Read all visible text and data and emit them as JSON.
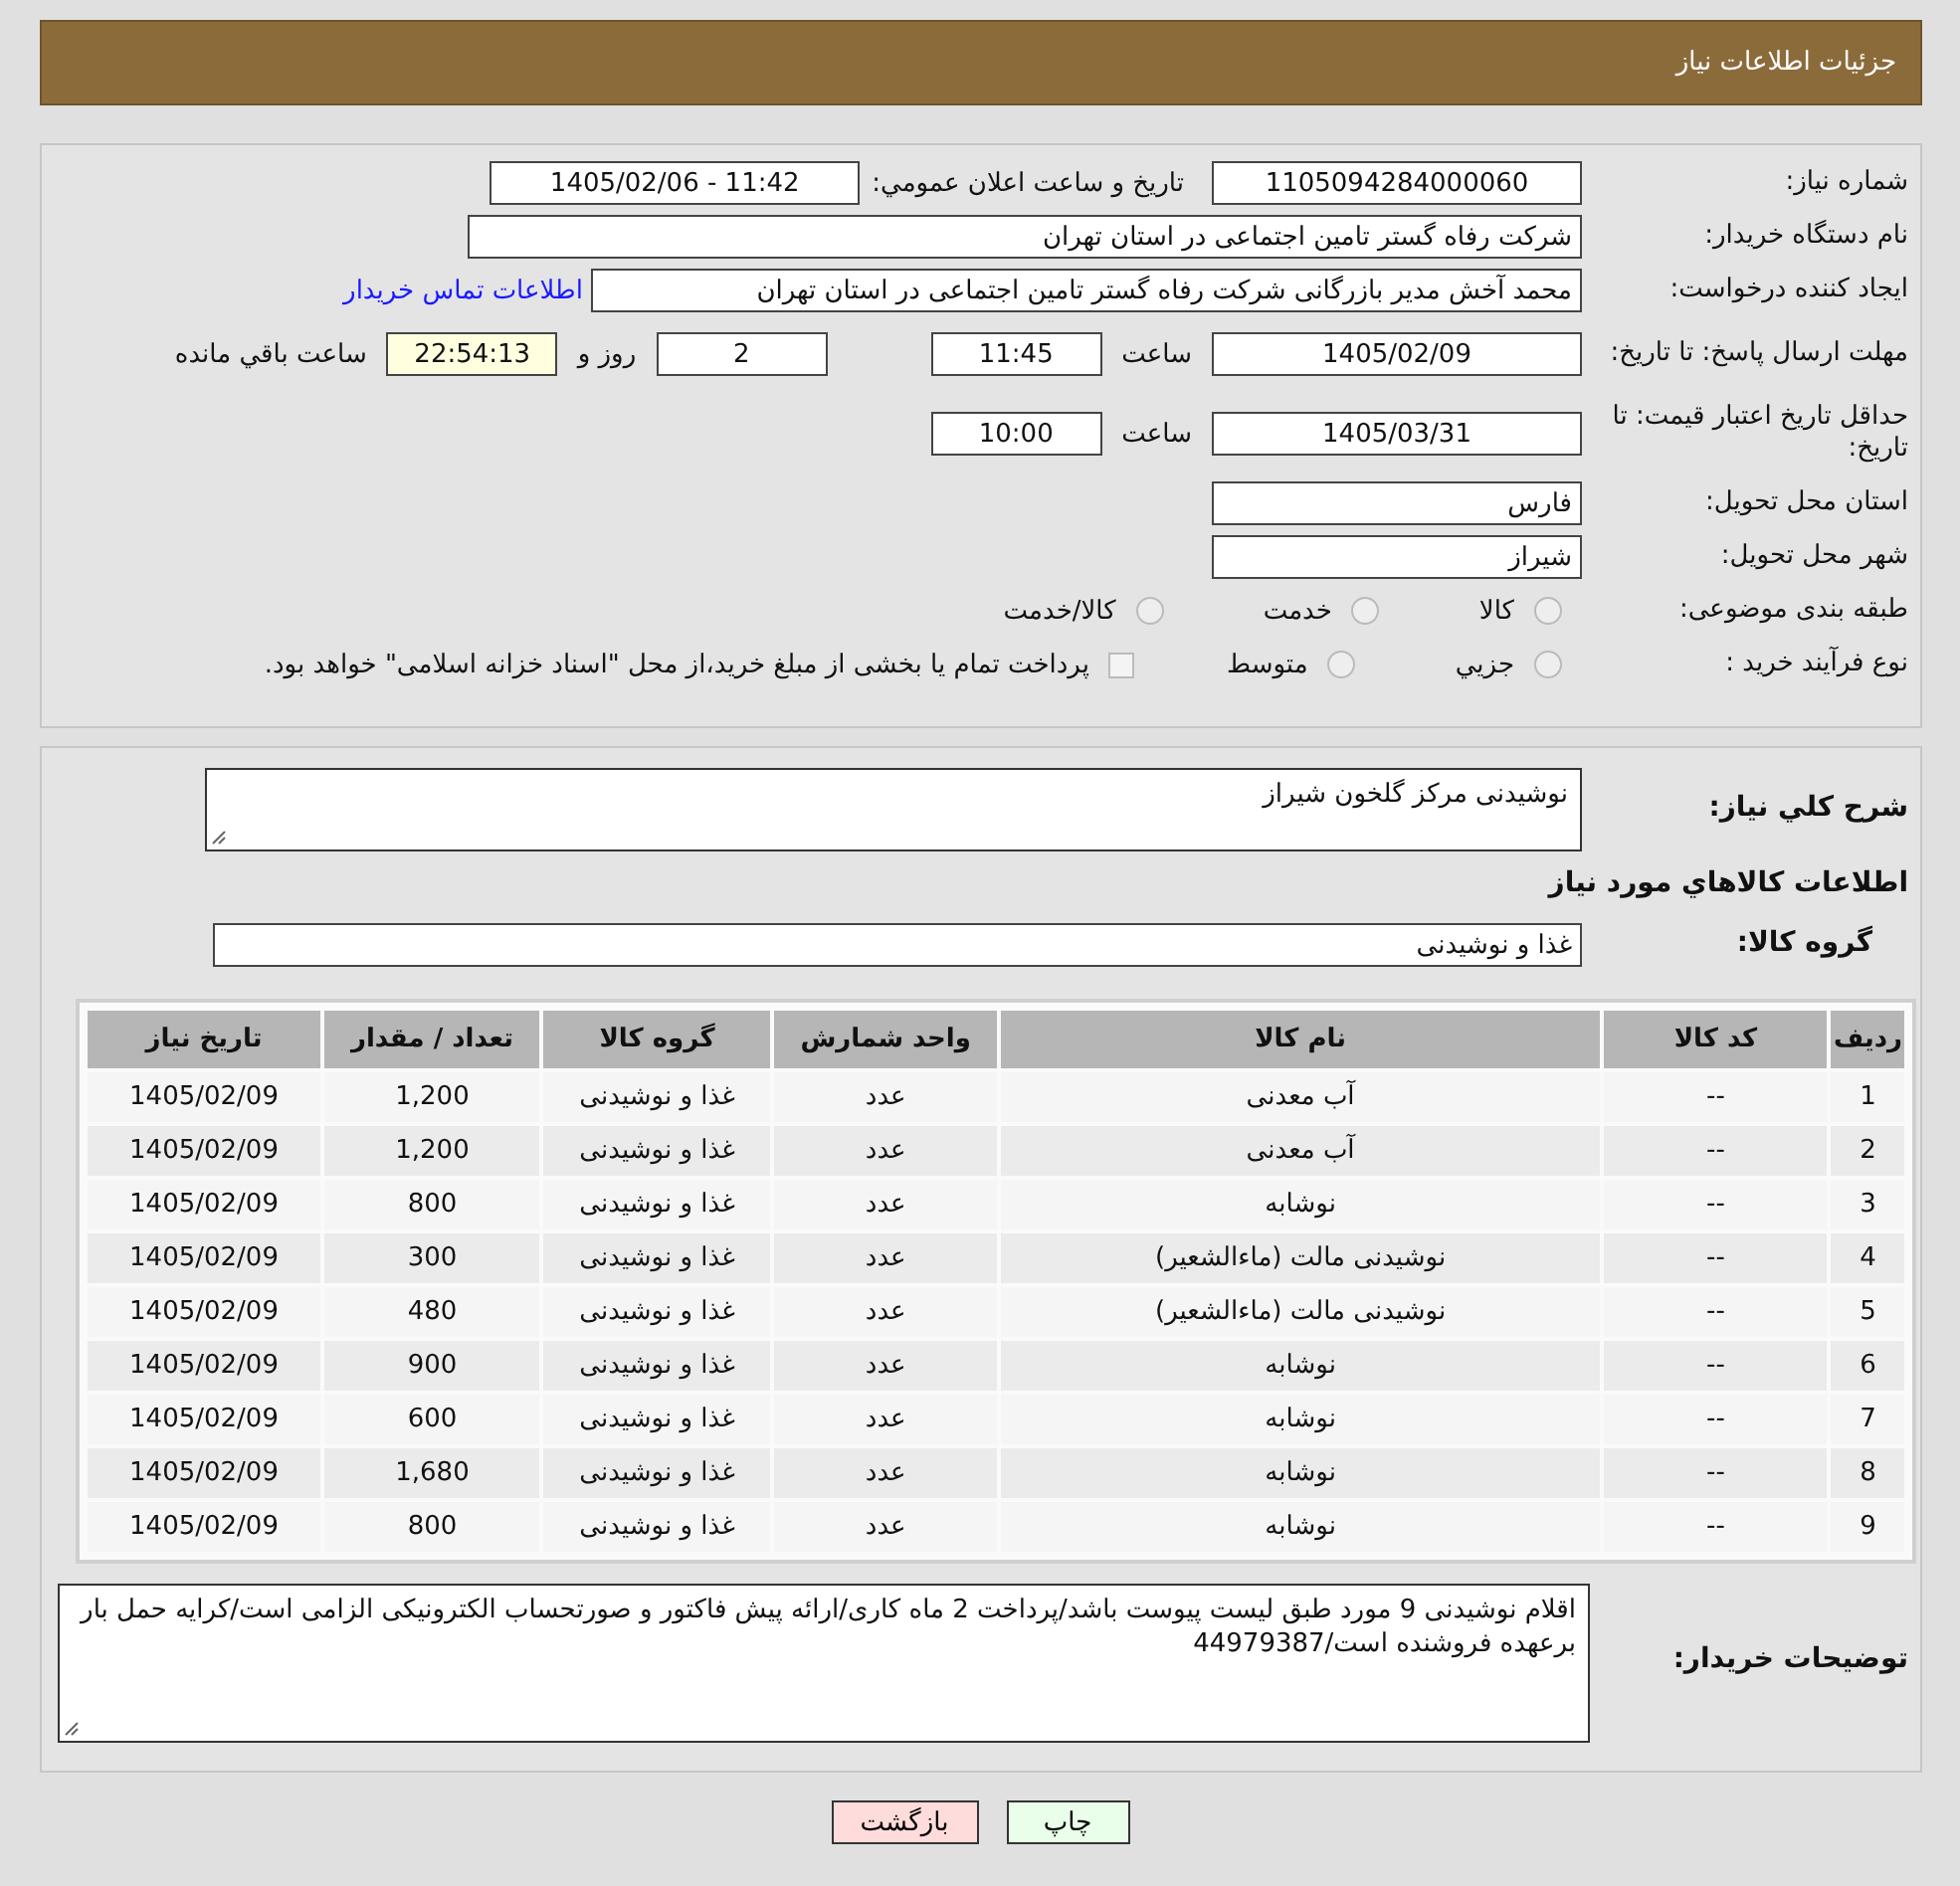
{
  "header": {
    "title": "جزئیات اطلاعات نیاز"
  },
  "need_number": {
    "label": "شماره نیاز:",
    "value": "1105094284000060"
  },
  "announce": {
    "label": "تاريخ و ساعت اعلان عمومي:",
    "value": "1405/02/06 - 11:42"
  },
  "buyer_org": {
    "label": "نام دستگاه خریدار:",
    "value": "شرکت رفاه گستر تامین اجتماعی در استان تهران"
  },
  "requester": {
    "label": "ایجاد کننده درخواست:",
    "value": "محمد آخش مدیر بازرگانی شرکت رفاه گستر تامین اجتماعی در استان تهران",
    "link": "اطلاعات تماس خریدار"
  },
  "deadline": {
    "label": "مهلت ارسال پاسخ: تا تاریخ:",
    "date": "1405/02/09",
    "time_label": "ساعت",
    "time": "11:45",
    "days": "2",
    "days_label": "روز و",
    "remaining": "22:54:13",
    "remaining_label": "ساعت باقي مانده"
  },
  "validity": {
    "label": "حداقل تاریخ اعتبار قیمت: تا تاریخ:",
    "date": "1405/03/31",
    "time_label": "ساعت",
    "time": "10:00"
  },
  "province": {
    "label": "استان محل تحویل:",
    "value": "فارس"
  },
  "city": {
    "label": "شهر محل تحویل:",
    "value": "شیراز"
  },
  "category": {
    "label": "طبقه بندی موضوعی:",
    "options": [
      {
        "label": "کالا",
        "selected": false
      },
      {
        "label": "خدمت",
        "selected": false
      },
      {
        "label": "کالا/خدمت",
        "selected": false
      }
    ]
  },
  "purchase_type": {
    "label": "نوع فرآیند خرید :",
    "options": [
      {
        "label": "جزيي",
        "selected": false
      },
      {
        "label": "متوسط",
        "selected": false
      }
    ],
    "note": {
      "text": "پرداخت تمام یا بخشی از مبلغ خرید،از محل \"اسناد خزانه اسلامی\" خواهد بود.",
      "checked": false
    }
  },
  "description": {
    "label": "شرح کلي نياز:",
    "value": "نوشیدنی مرکز گلخون شیراز"
  },
  "goods_title": "اطلاعات کالاهاي مورد نياز",
  "goods_group": {
    "label": "گروه کالا:",
    "value": "غذا و نوشیدنی"
  },
  "table": {
    "columns": [
      "ردیف",
      "کد کالا",
      "نام کالا",
      "واحد شمارش",
      "گروه کالا",
      "تعداد / مقدار",
      "تاریخ نیاز"
    ],
    "rows": [
      [
        "1",
        "--",
        "آب معدنی",
        "عدد",
        "غذا و نوشیدنی",
        "1,200",
        "1405/02/09"
      ],
      [
        "2",
        "--",
        "آب معدنی",
        "عدد",
        "غذا و نوشیدنی",
        "1,200",
        "1405/02/09"
      ],
      [
        "3",
        "--",
        "نوشابه",
        "عدد",
        "غذا و نوشیدنی",
        "800",
        "1405/02/09"
      ],
      [
        "4",
        "--",
        "نوشیدنی مالت (ماءالشعیر)",
        "عدد",
        "غذا و نوشیدنی",
        "300",
        "1405/02/09"
      ],
      [
        "5",
        "--",
        "نوشیدنی مالت (ماءالشعیر)",
        "عدد",
        "غذا و نوشیدنی",
        "480",
        "1405/02/09"
      ],
      [
        "6",
        "--",
        "نوشابه",
        "عدد",
        "غذا و نوشیدنی",
        "900",
        "1405/02/09"
      ],
      [
        "7",
        "--",
        "نوشابه",
        "عدد",
        "غذا و نوشیدنی",
        "600",
        "1405/02/09"
      ],
      [
        "8",
        "--",
        "نوشابه",
        "عدد",
        "غذا و نوشیدنی",
        "1,680",
        "1405/02/09"
      ],
      [
        "9",
        "--",
        "نوشابه",
        "عدد",
        "غذا و نوشیدنی",
        "800",
        "1405/02/09"
      ]
    ]
  },
  "buyer_notes": {
    "label": "توضیحات خریدار:",
    "value": "اقلام نوشیدنی 9 مورد طبق لیست پیوست باشد/پرداخت 2 ماه کاری/ارائه پیش فاکتور و صورتحساب الکترونیکی الزامی است/کرایه حمل بار برعهده فروشنده است/44979387"
  },
  "buttons": [
    {
      "label": "چاپ",
      "kind": "print"
    },
    {
      "label": "بازگشت",
      "kind": "back"
    }
  ]
}
